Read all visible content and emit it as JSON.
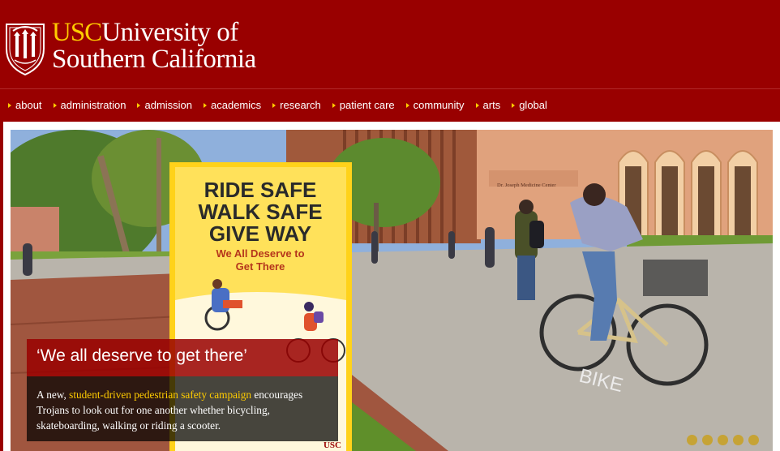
{
  "brand": {
    "usc": "USC",
    "name_line1": "University of",
    "name_line2": "Southern California"
  },
  "nav": {
    "items": [
      {
        "label": "about"
      },
      {
        "label": "administration"
      },
      {
        "label": "admission"
      },
      {
        "label": "academics"
      },
      {
        "label": "research"
      },
      {
        "label": "patient care"
      },
      {
        "label": "community"
      },
      {
        "label": "arts"
      },
      {
        "label": "global"
      }
    ]
  },
  "sign": {
    "line1": "RIDE SAFE",
    "line2": "WALK SAFE",
    "line3": "GIVE WAY",
    "sub1": "We All Deserve to",
    "sub2": "Get There",
    "logo": "USC"
  },
  "building_plaque": "Dr. Joseph Medicine Center",
  "caption": {
    "title": "‘We all deserve to get there’",
    "body_prefix": "A new, ",
    "body_link": "student-driven pedestrian safety campaign",
    "body_suffix": " encourages Trojans to look out for one another whether bicycling, skateboarding, walking or riding a scooter."
  },
  "carousel": {
    "slides": 5
  },
  "colors": {
    "cardinal": "#990000",
    "gold": "#ffcc00"
  }
}
